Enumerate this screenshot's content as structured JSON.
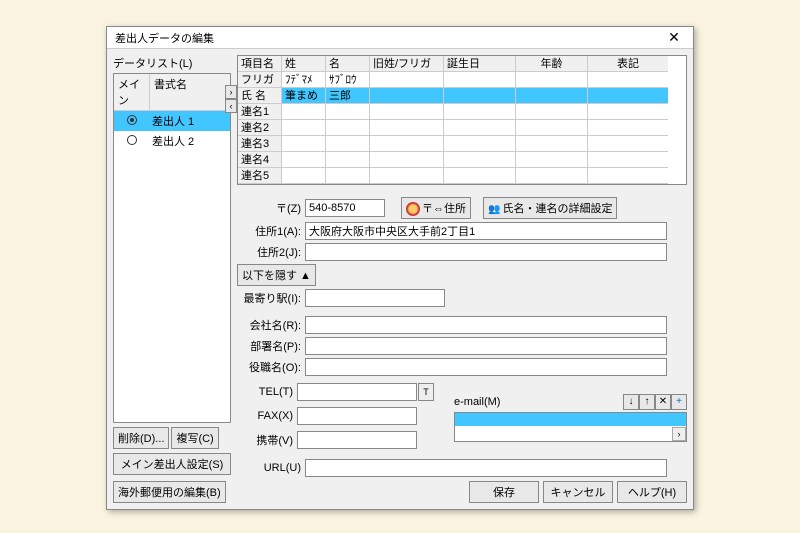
{
  "window": {
    "title": "差出人データの編集"
  },
  "datalist": {
    "label": "データリスト(L)",
    "cols": {
      "main": "メイン",
      "name": "書式名"
    },
    "rows": [
      {
        "label": "差出人 1",
        "selected": true,
        "radio_on": true
      },
      {
        "label": "差出人 2",
        "selected": false,
        "radio_on": false
      }
    ],
    "delete": "削除(D)...",
    "copy": "複写(C)",
    "main_sender": "メイン差出人設定(S)"
  },
  "name_table": {
    "headers": {
      "item": "項目名",
      "sei": "姓",
      "mei": "名",
      "old": "旧姓/フリガナ",
      "bday": "誕生日",
      "age": "年齢",
      "nota": "表記"
    },
    "rows": [
      {
        "item": "フリガナ",
        "sei": "ﾌﾃﾞﾏﾒ",
        "mei": "ｻﾌﾞﾛｳ",
        "old": "",
        "bday": "",
        "age": "",
        "nota": "",
        "sel": false
      },
      {
        "item": "氏 名",
        "sei": "筆まめ",
        "mei": "三郎",
        "old": "",
        "bday": "",
        "age": "",
        "nota": "",
        "sel": true
      },
      {
        "item": "連名1",
        "sei": "",
        "mei": "",
        "old": "",
        "bday": "",
        "age": "",
        "nota": "",
        "sel": false
      },
      {
        "item": "連名2",
        "sei": "",
        "mei": "",
        "old": "",
        "bday": "",
        "age": "",
        "nota": "",
        "sel": false
      },
      {
        "item": "連名3",
        "sei": "",
        "mei": "",
        "old": "",
        "bday": "",
        "age": "",
        "nota": "",
        "sel": false
      },
      {
        "item": "連名4",
        "sei": "",
        "mei": "",
        "old": "",
        "bday": "",
        "age": "",
        "nota": "",
        "sel": false
      },
      {
        "item": "連名5",
        "sei": "",
        "mei": "",
        "old": "",
        "bday": "",
        "age": "",
        "nota": "",
        "sel": false
      }
    ]
  },
  "form": {
    "zip_label": "〒(Z)",
    "zip_value": "540-8570",
    "zip_to_addr": "〒⇔住所",
    "name_detail": "氏名・連名の詳細設定",
    "addr1_label": "住所1(A):",
    "addr1_value": "大阪府大阪市中央区大手前2丁目1",
    "addr2_label": "住所2(J):",
    "addr2_value": "",
    "hide_below": "以下を隠す ▲",
    "station_label": "最寄り駅(I):",
    "station_value": "",
    "company_label": "会社名(R):",
    "company_value": "",
    "dept_label": "部署名(P):",
    "dept_value": "",
    "title_label": "役職名(O):",
    "title_value": "",
    "tel_label": "TEL(T)",
    "tel_value": "",
    "fax_label": "FAX(X)",
    "fax_value": "",
    "mobile_label": "携帯(V)",
    "mobile_value": "",
    "email_label": "e-mail(M)",
    "url_label": "URL(U)",
    "url_value": ""
  },
  "buttons": {
    "overseas": "海外郵便用の編集(B)",
    "save": "保存",
    "cancel": "キャンセル",
    "help": "ヘルプ(H)"
  }
}
